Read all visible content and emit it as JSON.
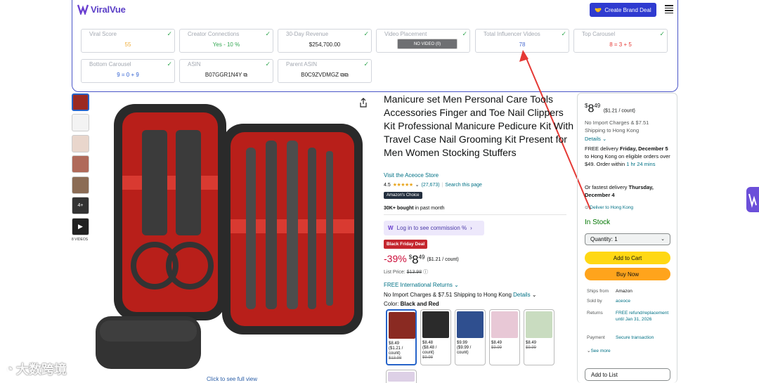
{
  "viralvue": {
    "logo_text": "ViralVue",
    "create_button": "Create Brand Deal",
    "cards": [
      {
        "label": "Viral Score",
        "value": "55",
        "color": "#f0b040"
      },
      {
        "label": "Creator Connections",
        "value": "Yes - 10 %",
        "color": "#34a853"
      },
      {
        "label": "30-Day Revenue",
        "value": "$254,700.00",
        "color": "#222222"
      },
      {
        "label": "Video Placement",
        "value": "NO VIDEO  (0)",
        "color": "#ffffff"
      },
      {
        "label": "Total Influencer Videos",
        "value": "78",
        "color": "#4a6cd0"
      },
      {
        "label": "Top Carousel",
        "value": "8 = 3 + 5",
        "color": "#e53935"
      },
      {
        "label": "Bottom Carousel",
        "value": "9 = 0 + 9",
        "color": "#2f5fd0"
      },
      {
        "label": "ASIN",
        "value": "B07GGR1N4Y",
        "color": "#222222"
      },
      {
        "label": "Parent ASIN",
        "value": "B0C9ZVDMGZ",
        "color": "#222222"
      }
    ]
  },
  "gallery": {
    "videos_label": "8 VIDEOS",
    "thumb_more": "4+",
    "see_full": "Click to see full view"
  },
  "product": {
    "title": "Manicure set Men Personal Care Tools Accessories Finger and Toe Nail Clippers Kit Professional Manicure Pedicure Kit With Travel Case Nail Grooming Kit Present for Men Women Stocking Stuffers",
    "store": "Visit the Aceoce Store",
    "rating": "4.5",
    "stars": "★★★★★",
    "reviews": "(27,673)",
    "search_page": "Search this page",
    "choice_badge": "Amazon's Choice",
    "bought_bold": "30K+ bought",
    "bought_rest": " in past month",
    "commission": "Log in to see commission %",
    "deal_badge": "Black Friday Deal",
    "discount": "-39%",
    "price_currency": "$",
    "price_whole": "8",
    "price_fraction": "49",
    "unit_price": "($1.21 / count)",
    "list_price_label": "List Price: ",
    "list_price": "$13.98",
    "free_returns": "FREE International Returns",
    "no_import": "No Import Charges & $7.51 Shipping to Hong Kong",
    "details": "Details",
    "color_label": "Color: ",
    "color_value": "Black and Red",
    "swatches": [
      {
        "price": "$8.49",
        "unit": "($1.21 / count)",
        "list": "$13.98",
        "bg": "#8a2a22"
      },
      {
        "price": "$8.48",
        "unit": "($8.48 / count)",
        "list": "$9.98",
        "bg": "#2b2b2b"
      },
      {
        "price": "$9.99",
        "unit": "($9.99 / count)",
        "list": "",
        "bg": "#2f4f8f"
      },
      {
        "price": "$8.49",
        "unit": "",
        "list": "$9.99",
        "bg": "#e8c8d6"
      },
      {
        "price": "$8.49",
        "unit": "",
        "list": "$9.99",
        "bg": "#c9dcc0"
      }
    ]
  },
  "buybox": {
    "price_currency": "$",
    "price_whole": "8",
    "price_fraction": "49",
    "unit_price": "($1.21 / count)",
    "import_line1": "No Import Charges & $7.51",
    "import_line2": "Shipping to Hong Kong",
    "details": "Details",
    "free_delivery": "FREE delivery ",
    "delivery_date": "Friday, December 5",
    "delivery_rest": " to Hong Kong on eligible orders over $49. Order within ",
    "order_within": "1 hr 24 mins",
    "fastest_prefix": "Or fastest delivery ",
    "fastest_date": "Thursday, December 4",
    "deliver_to": "Deliver to Hong Kong",
    "stock": "In Stock",
    "quantity": "Quantity: 1",
    "add_to_cart": "Add to Cart",
    "buy_now": "Buy Now",
    "ships_from_k": "Ships from",
    "ships_from_v": "Amazon",
    "sold_by_k": "Sold by",
    "sold_by_v": "aceoce",
    "returns_k": "Returns",
    "returns_v": "FREE refund/replacement until Jan 31, 2026",
    "payment_k": "Payment",
    "payment_v": "Secure transaction",
    "see_more": "See more",
    "add_to_list": "Add to List"
  },
  "watermark": "大数跨境"
}
